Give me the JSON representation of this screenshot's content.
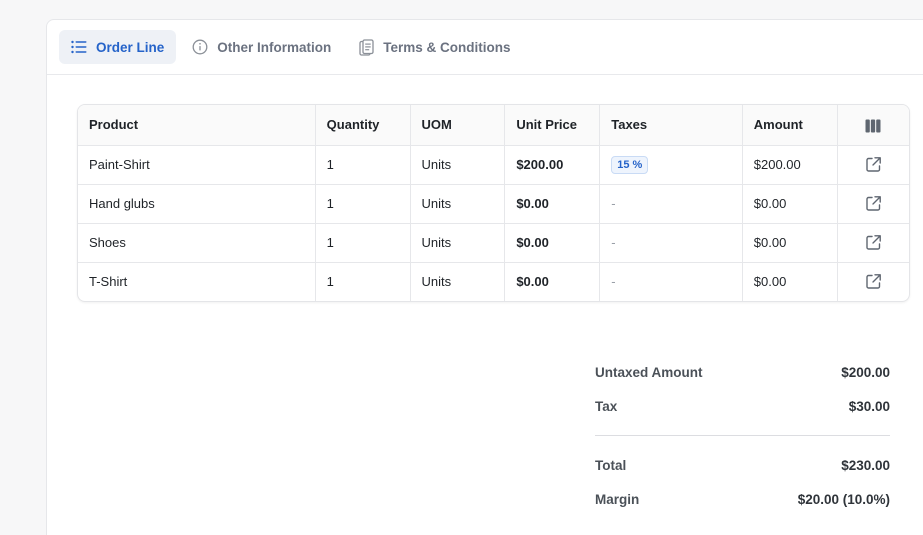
{
  "tabs": [
    {
      "label": "Order Line",
      "icon": "list-icon",
      "active": true
    },
    {
      "label": "Other Information",
      "icon": "info-circle-icon",
      "active": false
    },
    {
      "label": "Terms & Conditions",
      "icon": "clipboard-icon",
      "active": false
    }
  ],
  "table": {
    "headers": [
      "Product",
      "Quantity",
      "UOM",
      "Unit Price",
      "Taxes",
      "Amount"
    ],
    "columns_icon": "columns-icon",
    "rows": [
      {
        "product": "Paint-Shirt",
        "quantity": "1",
        "uom": "Units",
        "unit_price": "$200.00",
        "taxes": "15 %",
        "amount": "$200.00"
      },
      {
        "product": "Hand glubs",
        "quantity": "1",
        "uom": "Units",
        "unit_price": "$0.00",
        "taxes": "-",
        "amount": "$0.00"
      },
      {
        "product": "Shoes",
        "quantity": "1",
        "uom": "Units",
        "unit_price": "$0.00",
        "taxes": "-",
        "amount": "$0.00"
      },
      {
        "product": "T-Shirt",
        "quantity": "1",
        "uom": "Units",
        "unit_price": "$0.00",
        "taxes": "-",
        "amount": "$0.00"
      }
    ],
    "row_action_icon": "external-link-icon"
  },
  "totals": {
    "untaxed_label": "Untaxed Amount",
    "untaxed_value": "$200.00",
    "tax_label": "Tax",
    "tax_value": "$30.00",
    "total_label": "Total",
    "total_value": "$230.00",
    "margin_label": "Margin",
    "margin_value": "$20.00 (10.0%)"
  },
  "colors": {
    "accent": "#2563c9",
    "tab_active_bg": "#eef1f6",
    "badge_bg": "#eef4fd"
  }
}
